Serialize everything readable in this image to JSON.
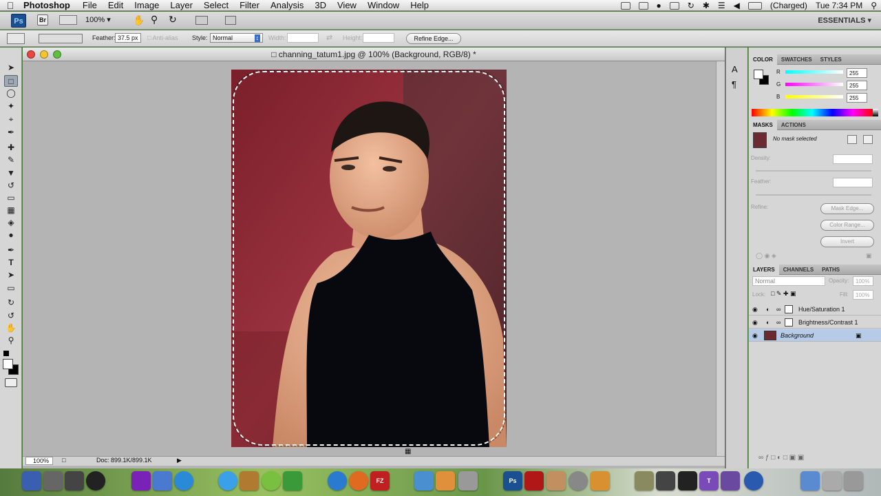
{
  "menubar": {
    "app_name": "Photoshop",
    "items": [
      "File",
      "Edit",
      "Image",
      "Layer",
      "Select",
      "Filter",
      "Analysis",
      "3D",
      "View",
      "Window",
      "Help"
    ],
    "battery": "(Charged)",
    "clock": "Tue 7:34 PM"
  },
  "appbar": {
    "logo": "Ps",
    "bridge": "Br",
    "zoom": "100%",
    "workspace": "ESSENTIALS ▾"
  },
  "options": {
    "feather_label": "Feather:",
    "feather_value": "37.5 px",
    "antialias_label": "Anti-alias",
    "style_label": "Style:",
    "style_value": "Normal",
    "width_label": "Width:",
    "height_label": "Height:",
    "refine_edge": "Refine Edge..."
  },
  "document": {
    "title": "channing_tatum1.jpg @ 100% (Background, RGB/8) *",
    "zoom": "100%",
    "doc_info": "Doc: 899.1K/899.1K"
  },
  "color_panel": {
    "tabs": [
      "COLOR",
      "SWATCHES",
      "STYLES"
    ],
    "r_label": "R",
    "r_value": "255",
    "g_label": "G",
    "g_value": "255",
    "b_label": "B",
    "b_value": "255"
  },
  "masks_panel": {
    "tabs": [
      "MASKS",
      "ACTIONS"
    ],
    "status": "No mask selected",
    "density_label": "Density:",
    "feather_label": "Feather:",
    "refine_label": "Refine:",
    "mask_edge": "Mask Edge...",
    "color_range": "Color Range...",
    "invert": "Invert"
  },
  "layers_panel": {
    "tabs": [
      "LAYERS",
      "CHANNELS",
      "PATHS"
    ],
    "blend_mode": "Normal",
    "opacity_label": "Opacity:",
    "opacity_value": "100%",
    "lock_label": "Lock:",
    "fill_label": "Fill:",
    "fill_value": "100%",
    "layers": [
      "Hue/Saturation 1",
      "Brightness/Contrast 1",
      "Background"
    ]
  },
  "colors": {
    "layer_selected": "#b6cbe8",
    "ps_blue": "#1a4f92",
    "red_light": "#e8463f",
    "yellow_light": "#f4c531",
    "green_light": "#5ec040"
  }
}
